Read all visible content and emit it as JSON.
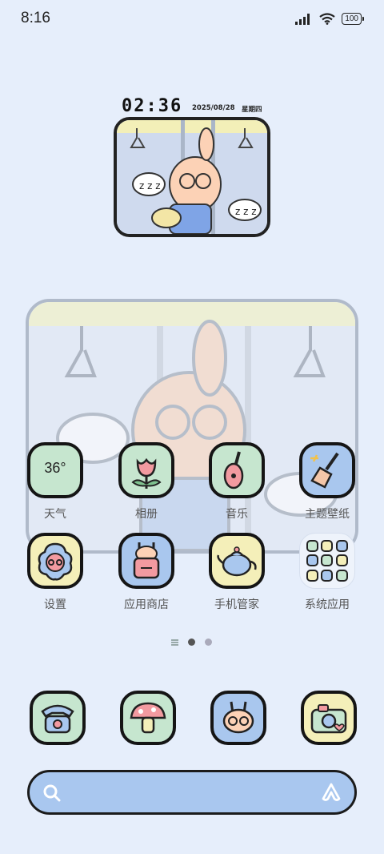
{
  "status": {
    "time": "8:16",
    "battery": "100"
  },
  "clock": {
    "time": "02:36",
    "date": "2025/08/28",
    "weekday": "星期四"
  },
  "apps_row1": [
    {
      "label": "天气",
      "icon": "weather-icon",
      "text": "36°"
    },
    {
      "label": "相册",
      "icon": "tulip-icon"
    },
    {
      "label": "音乐",
      "icon": "guitar-icon"
    },
    {
      "label": "主题壁纸",
      "icon": "brush-icon"
    }
  ],
  "apps_row2": [
    {
      "label": "设置",
      "icon": "bunny-face-icon"
    },
    {
      "label": "应用商店",
      "icon": "bunny-bag-icon"
    },
    {
      "label": "手机管家",
      "icon": "teapot-icon"
    },
    {
      "label": "系统应用",
      "icon": "folder-icon"
    }
  ],
  "dock": [
    {
      "icon": "telephone-icon"
    },
    {
      "icon": "mushroom-icon"
    },
    {
      "icon": "bunny-glasses-icon"
    },
    {
      "icon": "camera-icon"
    }
  ],
  "pager": {
    "count": 2,
    "active": 0
  },
  "colors": {
    "background": "#e6eefb",
    "green": "#c6e6cf",
    "blue": "#a9c7ee",
    "yellow": "#f4efb9"
  }
}
